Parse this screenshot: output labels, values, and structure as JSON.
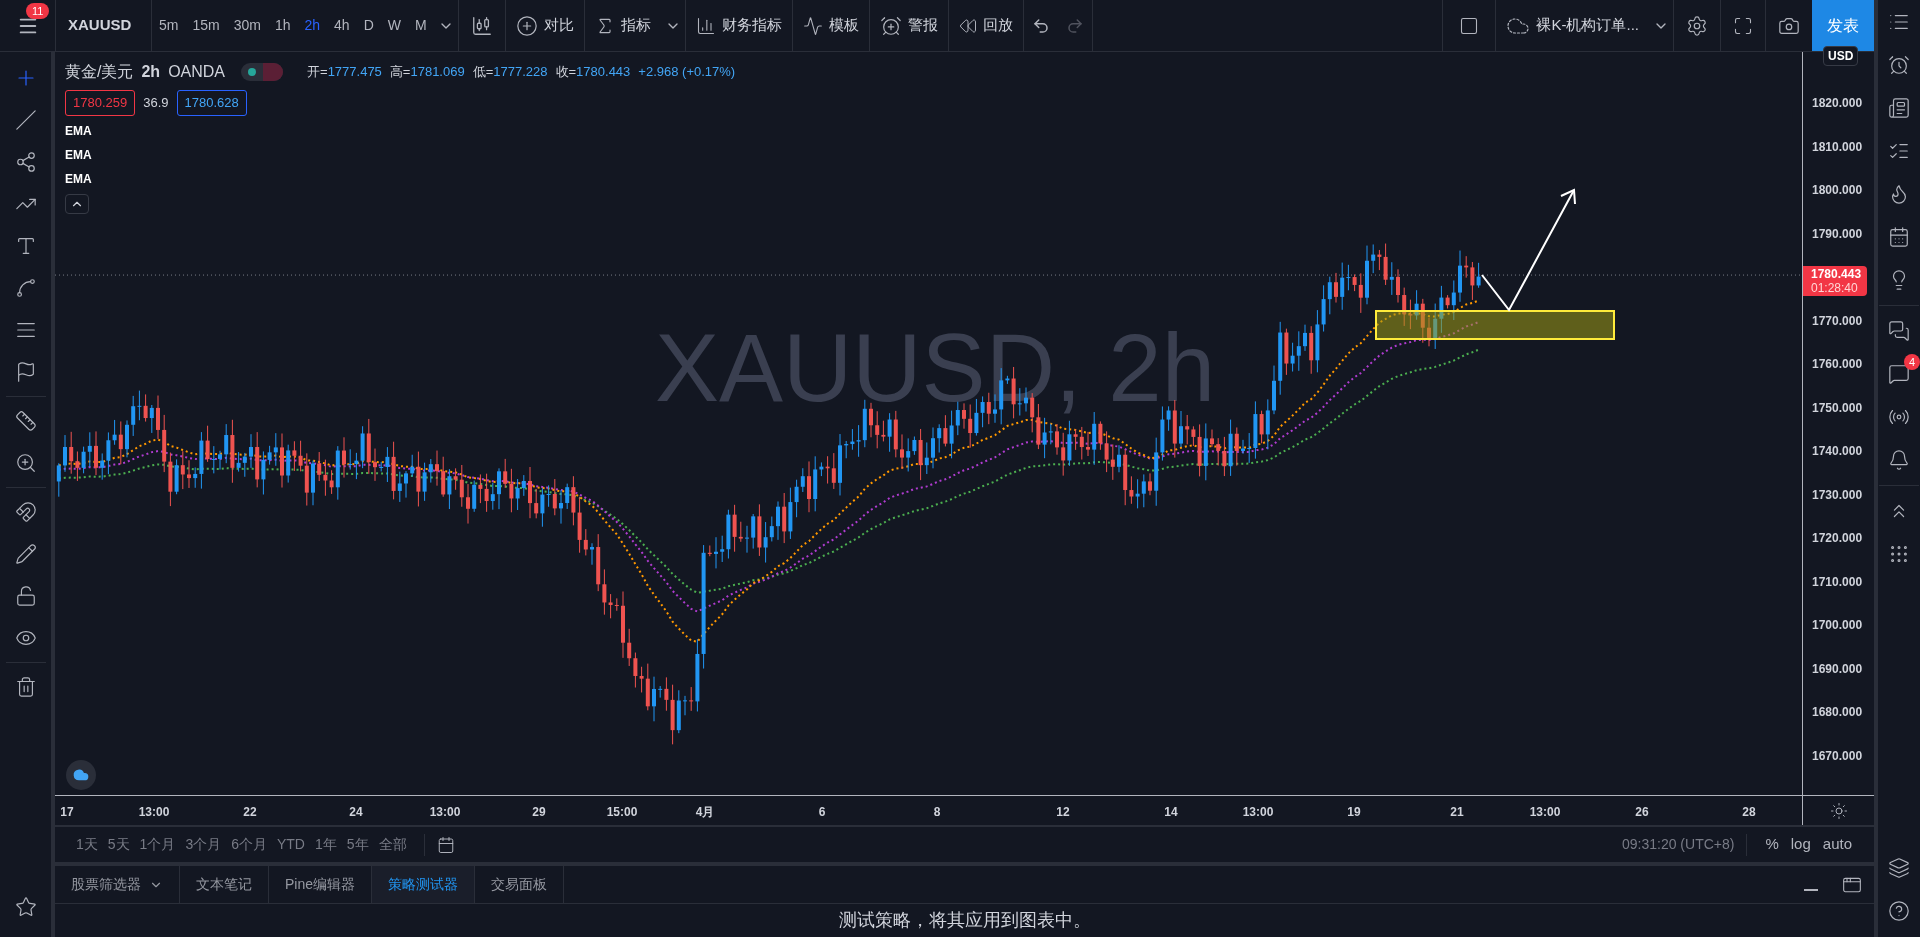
{
  "top_bar": {
    "menu_badge": "11",
    "symbol": "XAUUSD",
    "intervals": [
      {
        "label": "5m",
        "selected": false
      },
      {
        "label": "15m",
        "selected": false
      },
      {
        "label": "30m",
        "selected": false
      },
      {
        "label": "1h",
        "selected": false
      },
      {
        "label": "2h",
        "selected": true
      },
      {
        "label": "4h",
        "selected": false
      },
      {
        "label": "D",
        "selected": false
      },
      {
        "label": "W",
        "selected": false
      },
      {
        "label": "M",
        "selected": false
      }
    ],
    "compare": "对比",
    "indicators": "指标",
    "financials": "财务指标",
    "templates": "模板",
    "alert": "警报",
    "replay": "回放",
    "layout_name": "裸K-机构订单...",
    "publish": "发表"
  },
  "legend": {
    "title": "黄金/美元",
    "interval": "2h",
    "source": "OANDA",
    "ohlc": [
      {
        "label": "开=",
        "value": "1777.475"
      },
      {
        "label": "高=",
        "value": "1781.069"
      },
      {
        "label": "低=",
        "value": "1777.228"
      },
      {
        "label": "收=",
        "value": "1780.443"
      }
    ],
    "change": "+2.968 (+0.17%)",
    "bid": "1780.259",
    "spread": "36.9",
    "ask": "1780.628",
    "indicators": [
      "EMA",
      "EMA",
      "EMA"
    ]
  },
  "watermark": {
    "symbol": "XAUUSD, 2h"
  },
  "price_axis": {
    "currency": "USD",
    "ticks": [
      "1820.000",
      "1810.000",
      "1800.000",
      "1790.000",
      "1770.000",
      "1760.000",
      "1750.000",
      "1740.000",
      "1730.000",
      "1720.000",
      "1710.000",
      "1700.000",
      "1690.000",
      "1680.000",
      "1670.000"
    ],
    "last_price": "1780.443",
    "countdown": "01:28:40"
  },
  "time_axis": {
    "ticks": [
      "17",
      "13:00",
      "22",
      "24",
      "13:00",
      "29",
      "15:00",
      "4月",
      "6",
      "8",
      "12",
      "14",
      "13:00",
      "19",
      "21",
      "13:00",
      "26",
      "28"
    ]
  },
  "range_bar": {
    "ranges": [
      "1天",
      "5天",
      "1个月",
      "3个月",
      "6个月",
      "YTD",
      "1年",
      "5年",
      "全部"
    ],
    "clock": "09:31:20 (UTC+8)",
    "options": [
      "%",
      "log",
      "auto"
    ]
  },
  "bottom_panel": {
    "tabs": [
      {
        "label": "股票筛选器",
        "selected": false
      },
      {
        "label": "文本笔记",
        "selected": false
      },
      {
        "label": "Pine编辑器",
        "selected": false
      },
      {
        "label": "策略测试器",
        "selected": true
      },
      {
        "label": "交易面板",
        "selected": false
      }
    ],
    "message": "测试策略，将其应用到图表中。"
  },
  "right_sidebar": {
    "chat_badge": "4"
  }
}
